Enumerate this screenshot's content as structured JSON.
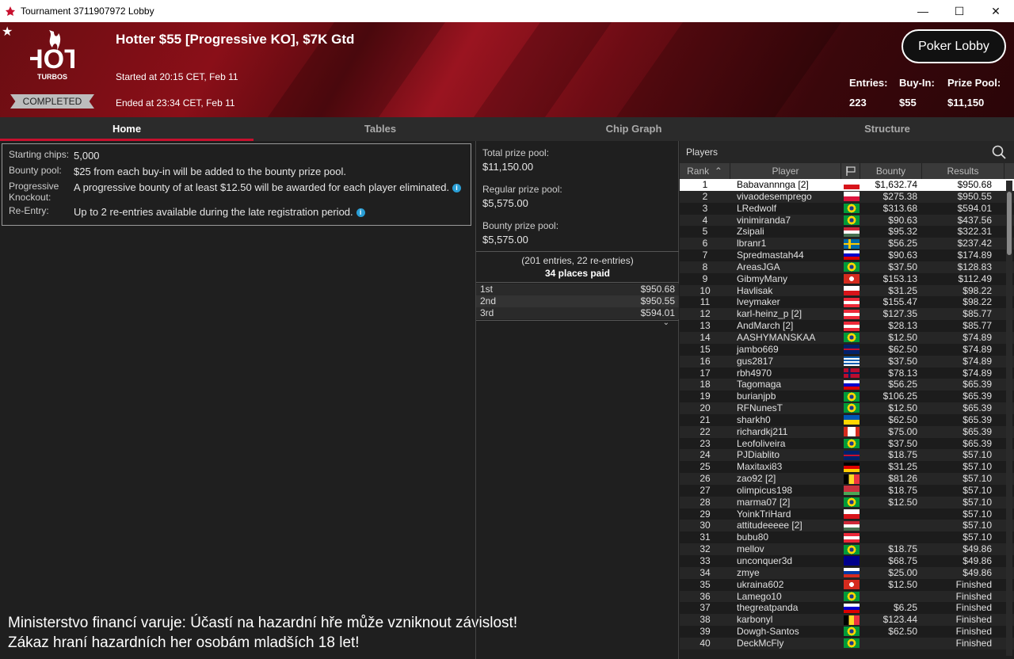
{
  "window": {
    "title": "Tournament 3711907972 Lobby"
  },
  "header": {
    "name": "Hotter $55 [Progressive KO], $7K Gtd",
    "started": "Started at 20:15 CET, Feb 11",
    "ended": "Ended at 23:34 CET, Feb 11",
    "status": "COMPLETED",
    "lobby_button": "Poker Lobby",
    "logo_text_top": "HOT",
    "logo_text_bottom": "TURBOS",
    "stats": [
      {
        "label": "Entries:",
        "value": "223"
      },
      {
        "label": "Buy-In:",
        "value": "$55"
      },
      {
        "label": "Prize Pool:",
        "value": "$11,150"
      }
    ]
  },
  "tabs": [
    "Home",
    "Tables",
    "Chip Graph",
    "Structure"
  ],
  "info": [
    {
      "label": "Starting chips:",
      "value": "5,000",
      "info_icon": false
    },
    {
      "label": "Bounty pool:",
      "value": "$25 from each buy-in will be added to the bounty prize pool.",
      "info_icon": false
    },
    {
      "label": "Progressive Knockout:",
      "value": "A progressive bounty of at least $12.50 will be awarded for each player eliminated.",
      "info_icon": true
    },
    {
      "label": "Re-Entry:",
      "value": "Up to 2 re-entries available during the late registration period.",
      "info_icon": true
    }
  ],
  "info_icon_glyph": "i",
  "warning": {
    "line1": "Ministerstvo financí varuje: Účastí na hazardní hře může vzniknout závislost!",
    "line2": "Zákaz hraní hazardních her osobám mladších 18 let!"
  },
  "prize": {
    "total_label": "Total prize pool:",
    "total_value": "$11,150.00",
    "regular_label": "Regular prize pool:",
    "regular_value": "$5,575.00",
    "bounty_label": "Bounty prize pool:",
    "bounty_value": "$5,575.00",
    "entries_note": "(201 entries, 22 re-entries)",
    "places_paid": "34 places paid",
    "payouts": [
      {
        "place": "1st",
        "amount": "$950.68"
      },
      {
        "place": "2nd",
        "amount": "$950.55"
      },
      {
        "place": "3rd",
        "amount": "$594.01"
      }
    ]
  },
  "players": {
    "title": "Players",
    "columns": {
      "rank": "Rank",
      "player": "Player",
      "bounty": "Bounty",
      "results": "Results"
    },
    "rows": [
      {
        "rank": "1",
        "player": "Babavannnga [2]",
        "flag": "cz",
        "bounty": "$1,632.74",
        "result": "$950.68"
      },
      {
        "rank": "2",
        "player": "vivaodesemprego",
        "flag": "pl",
        "bounty": "$275.38",
        "result": "$950.55"
      },
      {
        "rank": "3",
        "player": "LRedwolf",
        "flag": "br",
        "bounty": "$313.68",
        "result": "$594.01"
      },
      {
        "rank": "4",
        "player": "vinimiranda7",
        "flag": "br",
        "bounty": "$90.63",
        "result": "$437.56"
      },
      {
        "rank": "5",
        "player": "Zsipali",
        "flag": "hu",
        "bounty": "$95.32",
        "result": "$322.31"
      },
      {
        "rank": "6",
        "player": "lbranr1",
        "flag": "se",
        "bounty": "$56.25",
        "result": "$237.42"
      },
      {
        "rank": "7",
        "player": "Spredmastah44",
        "flag": "si",
        "bounty": "$90.63",
        "result": "$174.89"
      },
      {
        "rank": "8",
        "player": "AreasJGA",
        "flag": "br",
        "bounty": "$37.50",
        "result": "$128.83"
      },
      {
        "rank": "9",
        "player": "GibmyMany",
        "flag": "ch",
        "bounty": "$153.13",
        "result": "$112.49"
      },
      {
        "rank": "10",
        "player": "Havlisak",
        "flag": "cz",
        "bounty": "$31.25",
        "result": "$98.22"
      },
      {
        "rank": "11",
        "player": "lveymaker",
        "flag": "at",
        "bounty": "$155.47",
        "result": "$98.22"
      },
      {
        "rank": "12",
        "player": "karl-heinz_p [2]",
        "flag": "at",
        "bounty": "$127.35",
        "result": "$85.77"
      },
      {
        "rank": "13",
        "player": "AndMarch [2]",
        "flag": "at",
        "bounty": "$28.13",
        "result": "$85.77"
      },
      {
        "rank": "14",
        "player": "AASHYMANSKAA",
        "flag": "br",
        "bounty": "$12.50",
        "result": "$74.89"
      },
      {
        "rank": "15",
        "player": "jambo669",
        "flag": "gb",
        "bounty": "$62.50",
        "result": "$74.89"
      },
      {
        "rank": "16",
        "player": "gus2817",
        "flag": "gr",
        "bounty": "$37.50",
        "result": "$74.89"
      },
      {
        "rank": "17",
        "player": "rbh4970",
        "flag": "no",
        "bounty": "$78.13",
        "result": "$74.89"
      },
      {
        "rank": "18",
        "player": "Tagomaga",
        "flag": "si",
        "bounty": "$56.25",
        "result": "$65.39"
      },
      {
        "rank": "19",
        "player": "burianjpb",
        "flag": "br",
        "bounty": "$106.25",
        "result": "$65.39"
      },
      {
        "rank": "20",
        "player": "RFNunesT",
        "flag": "br",
        "bounty": "$12.50",
        "result": "$65.39"
      },
      {
        "rank": "21",
        "player": "sharkh0",
        "flag": "ua",
        "bounty": "$62.50",
        "result": "$65.39"
      },
      {
        "rank": "22",
        "player": "richardkj211",
        "flag": "ca",
        "bounty": "$75.00",
        "result": "$65.39"
      },
      {
        "rank": "23",
        "player": "Leofoliveira",
        "flag": "br",
        "bounty": "$37.50",
        "result": "$65.39"
      },
      {
        "rank": "24",
        "player": "PJDiablito",
        "flag": "gb",
        "bounty": "$18.75",
        "result": "$57.10"
      },
      {
        "rank": "25",
        "player": "Maxitaxi83",
        "flag": "de",
        "bounty": "$31.25",
        "result": "$57.10"
      },
      {
        "rank": "26",
        "player": "zao92 [2]",
        "flag": "be",
        "bounty": "$81.26",
        "result": "$57.10"
      },
      {
        "rank": "27",
        "player": "olimpicus198",
        "flag": "by",
        "bounty": "$18.75",
        "result": "$57.10"
      },
      {
        "rank": "28",
        "player": "marma07 [2]",
        "flag": "br",
        "bounty": "$12.50",
        "result": "$57.10"
      },
      {
        "rank": "29",
        "player": "YoinkTriHard",
        "flag": "cz",
        "bounty": "",
        "result": "$57.10"
      },
      {
        "rank": "30",
        "player": "attitudeeeee [2]",
        "flag": "hu",
        "bounty": "",
        "result": "$57.10"
      },
      {
        "rank": "31",
        "player": "bubu80",
        "flag": "at",
        "bounty": "",
        "result": "$57.10"
      },
      {
        "rank": "32",
        "player": "mellov",
        "flag": "br",
        "bounty": "$18.75",
        "result": "$49.86"
      },
      {
        "rank": "33",
        "player": "unconquer3d",
        "flag": "au",
        "bounty": "$68.75",
        "result": "$49.86"
      },
      {
        "rank": "34",
        "player": "zmye",
        "flag": "ru",
        "bounty": "$25.00",
        "result": "$49.86"
      },
      {
        "rank": "35",
        "player": "ukraina602",
        "flag": "ch",
        "bounty": "$12.50",
        "result": "Finished"
      },
      {
        "rank": "36",
        "player": "Lamego10",
        "flag": "br",
        "bounty": "",
        "result": "Finished"
      },
      {
        "rank": "37",
        "player": "thegreatpanda",
        "flag": "si",
        "bounty": "$6.25",
        "result": "Finished"
      },
      {
        "rank": "38",
        "player": "karbonyl",
        "flag": "be",
        "bounty": "$123.44",
        "result": "Finished"
      },
      {
        "rank": "39",
        "player": "Dowgh-Santos",
        "flag": "br",
        "bounty": "$62.50",
        "result": "Finished"
      },
      {
        "rank": "40",
        "player": "DeckMcFly",
        "flag": "br",
        "bounty": "",
        "result": "Finished"
      }
    ]
  },
  "colors": {
    "accent": "#c8102e",
    "banner": "#8a0f18",
    "info_dot": "#2a9fd6"
  },
  "icons": {
    "star": "star-icon",
    "search": "search-icon",
    "flag_column": "flag-icon",
    "sort": "sort-up-icon",
    "expand": "chevron-down-icon"
  }
}
